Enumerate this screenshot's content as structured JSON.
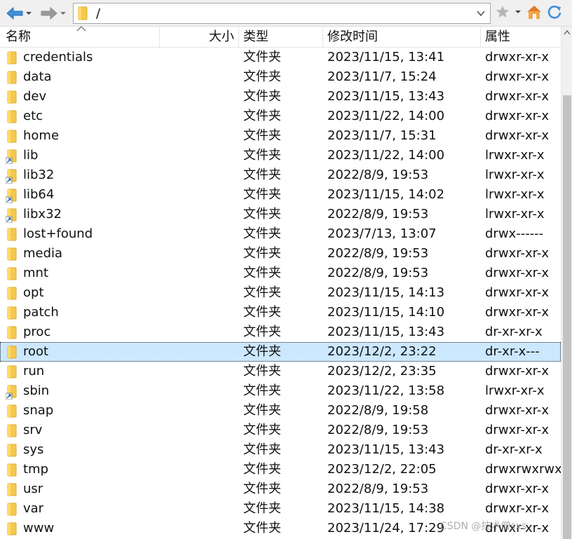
{
  "colors": {
    "folder": "#f6c94d",
    "selected_row": "#cce8ff",
    "nav_blue": "#3f8fd8"
  },
  "toolbar": {
    "back_icon": "arrow-left-icon",
    "forward_icon": "arrow-right-icon",
    "path": "/",
    "bookmark_icon": "star-icon",
    "home_icon": "home-icon",
    "refresh_icon": "refresh-icon"
  },
  "columns": {
    "name": "名称",
    "size": "大小",
    "type": "类型",
    "modified": "修改时间",
    "attr": "属性"
  },
  "files": [
    {
      "name": "credentials",
      "type": "文件夹",
      "modified": "2023/11/15, 13:41",
      "attr": "drwxr-xr-x",
      "link": false
    },
    {
      "name": "data",
      "type": "文件夹",
      "modified": "2023/11/7, 15:24",
      "attr": "drwxr-xr-x",
      "link": false
    },
    {
      "name": "dev",
      "type": "文件夹",
      "modified": "2023/11/15, 13:43",
      "attr": "drwxr-xr-x",
      "link": false
    },
    {
      "name": "etc",
      "type": "文件夹",
      "modified": "2023/11/22, 14:00",
      "attr": "drwxr-xr-x",
      "link": false
    },
    {
      "name": "home",
      "type": "文件夹",
      "modified": "2023/11/7, 15:31",
      "attr": "drwxr-xr-x",
      "link": false
    },
    {
      "name": "lib",
      "type": "文件夹",
      "modified": "2023/11/22, 14:00",
      "attr": "lrwxr-xr-x",
      "link": true
    },
    {
      "name": "lib32",
      "type": "文件夹",
      "modified": "2022/8/9, 19:53",
      "attr": "lrwxr-xr-x",
      "link": true
    },
    {
      "name": "lib64",
      "type": "文件夹",
      "modified": "2023/11/15, 14:02",
      "attr": "lrwxr-xr-x",
      "link": true
    },
    {
      "name": "libx32",
      "type": "文件夹",
      "modified": "2022/8/9, 19:53",
      "attr": "lrwxr-xr-x",
      "link": true
    },
    {
      "name": "lost+found",
      "type": "文件夹",
      "modified": "2023/7/13, 13:07",
      "attr": "drwx------",
      "link": false
    },
    {
      "name": "media",
      "type": "文件夹",
      "modified": "2022/8/9, 19:53",
      "attr": "drwxr-xr-x",
      "link": false
    },
    {
      "name": "mnt",
      "type": "文件夹",
      "modified": "2022/8/9, 19:53",
      "attr": "drwxr-xr-x",
      "link": false
    },
    {
      "name": "opt",
      "type": "文件夹",
      "modified": "2023/11/15, 14:13",
      "attr": "drwxr-xr-x",
      "link": false
    },
    {
      "name": "patch",
      "type": "文件夹",
      "modified": "2023/11/15, 14:10",
      "attr": "drwxr-xr-x",
      "link": false
    },
    {
      "name": "proc",
      "type": "文件夹",
      "modified": "2023/11/15, 13:43",
      "attr": "dr-xr-xr-x",
      "link": false
    },
    {
      "name": "root",
      "type": "文件夹",
      "modified": "2023/12/2, 23:22",
      "attr": "dr-xr-x---",
      "link": false,
      "selected": true
    },
    {
      "name": "run",
      "type": "文件夹",
      "modified": "2023/12/2, 23:35",
      "attr": "drwxr-xr-x",
      "link": false
    },
    {
      "name": "sbin",
      "type": "文件夹",
      "modified": "2023/11/22, 13:58",
      "attr": "lrwxr-xr-x",
      "link": true
    },
    {
      "name": "snap",
      "type": "文件夹",
      "modified": "2022/8/9, 19:58",
      "attr": "drwxr-xr-x",
      "link": false
    },
    {
      "name": "srv",
      "type": "文件夹",
      "modified": "2022/8/9, 19:53",
      "attr": "drwxr-xr-x",
      "link": false
    },
    {
      "name": "sys",
      "type": "文件夹",
      "modified": "2023/11/15, 13:43",
      "attr": "dr-xr-xr-x",
      "link": false
    },
    {
      "name": "tmp",
      "type": "文件夹",
      "modified": "2023/12/2, 22:05",
      "attr": "drwxrwxrwx",
      "link": false
    },
    {
      "name": "usr",
      "type": "文件夹",
      "modified": "2022/8/9, 19:53",
      "attr": "drwxr-xr-x",
      "link": false
    },
    {
      "name": "var",
      "type": "文件夹",
      "modified": "2023/11/15, 14:38",
      "attr": "drwxr-xr-x",
      "link": false
    },
    {
      "name": "www",
      "type": "文件夹",
      "modified": "2023/11/24, 17:29",
      "attr": "drwxr-xr-x",
      "link": false
    }
  ],
  "watermark": "CSDN @技术僧sxs"
}
